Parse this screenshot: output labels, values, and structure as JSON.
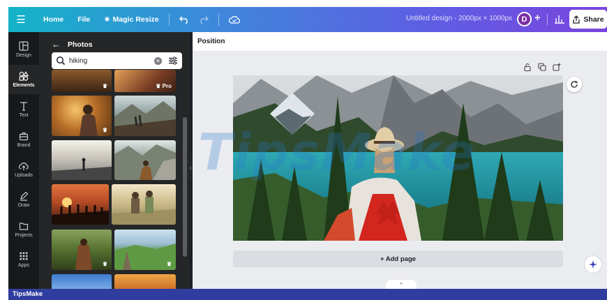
{
  "topbar": {
    "home_label": "Home",
    "file_label": "File",
    "magic_resize_label": "Magic Resize",
    "document_title": "Untitled design - 2000px × 1000px",
    "avatar_initial": "D",
    "share_label": "Share"
  },
  "sidebar": {
    "items": [
      {
        "label": "Design",
        "icon": "layout-icon"
      },
      {
        "label": "Elements",
        "icon": "shapes-icon"
      },
      {
        "label": "Text",
        "icon": "text-icon"
      },
      {
        "label": "Brand",
        "icon": "briefcase-icon"
      },
      {
        "label": "Uploads",
        "icon": "cloud-upload-icon"
      },
      {
        "label": "Draw",
        "icon": "pen-icon"
      },
      {
        "label": "Projects",
        "icon": "folder-icon"
      },
      {
        "label": "Apps",
        "icon": "grid-icon"
      }
    ],
    "active_index": 1
  },
  "panel": {
    "title": "Photos",
    "search_value": "hiking",
    "pro_badge": "Pro"
  },
  "toolbar": {
    "position_label": "Position"
  },
  "canvas": {
    "add_page_label": "+ Add page"
  },
  "watermark": {
    "text": "TipsMake"
  },
  "footer": {
    "brand": "TipsMake"
  },
  "colors": {
    "topbar_start": "#14b3c9",
    "topbar_end": "#7a45dd",
    "rail_bg": "#18191b",
    "panel_bg": "#252627",
    "canvas_bg": "#ebecf0",
    "footer_bg": "#2f3e9e"
  }
}
